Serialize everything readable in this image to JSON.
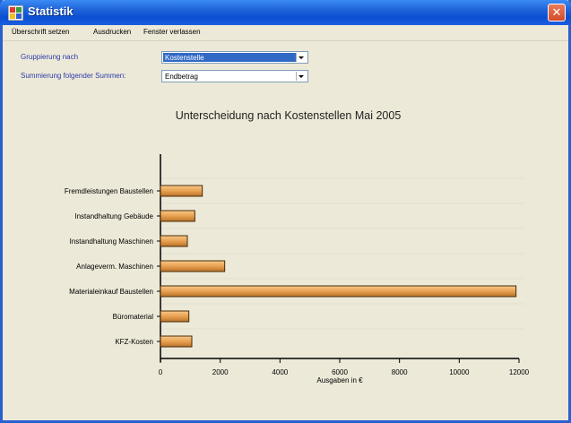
{
  "window": {
    "title": "Statistik",
    "close_glyph": "✕"
  },
  "menu": {
    "items": [
      "Überschrift setzen",
      "Ausdrucken",
      "Fenster verlassen"
    ]
  },
  "form": {
    "grouping_label": "Gruppierung nach",
    "grouping_value": "Kostenstelle",
    "summing_label": "Summierung folgender Summen:",
    "summing_value": "Endbetrag"
  },
  "chart_data": {
    "type": "bar",
    "orientation": "horizontal",
    "title": "Unterscheidung nach Kostenstellen Mai 2005",
    "xlabel": "Ausgaben in €",
    "ylabel": "",
    "categories": [
      "Fremdleistungen Baustellen",
      "Instandhaltung Gebäude",
      "Instandhaltung Maschinen",
      "Anlageverm. Maschinen",
      "Materialeinkauf Baustellen",
      "Büromaterial",
      "KFZ-Kosten"
    ],
    "values": [
      1400,
      1150,
      900,
      2150,
      11900,
      950,
      1050
    ],
    "xlim": [
      0,
      12000
    ],
    "xticks": [
      0,
      2000,
      4000,
      6000,
      8000,
      10000,
      12000
    ],
    "bar_color": "#e8a050",
    "grid": true
  }
}
